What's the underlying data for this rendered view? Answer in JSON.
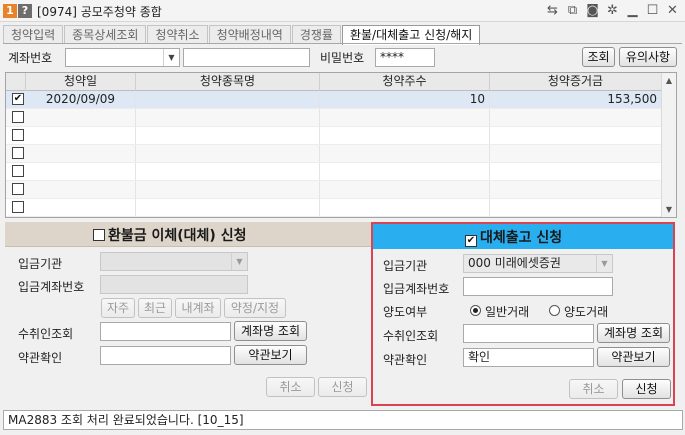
{
  "window": {
    "badge1": "1",
    "badge2": "?",
    "title": "[0974] 공모주청약 종합",
    "icons": [
      "sync-icon",
      "copy-icon",
      "camera-icon",
      "gear-icon",
      "minimize-icon",
      "restore-icon",
      "close-icon"
    ]
  },
  "tabs": [
    {
      "label": "청약입력"
    },
    {
      "label": "종목상세조회"
    },
    {
      "label": "청약취소"
    },
    {
      "label": "청약배정내역"
    },
    {
      "label": "경쟁률"
    },
    {
      "label": "환불/대체출고 신청/해지"
    }
  ],
  "active_tab": 5,
  "search": {
    "account_label": "계좌번호",
    "account_value": "",
    "account_name_value": "",
    "password_label": "비밀번호",
    "password_value": "****",
    "query_button": "조회",
    "notice_button": "유의사항"
  },
  "grid": {
    "headers": [
      "청약일",
      "청약종목명",
      "청약주수",
      "청약증거금"
    ],
    "rows": [
      {
        "checked": true,
        "date": "2020/09/09",
        "name": "",
        "qty": "10",
        "deposit": "153,500"
      },
      {
        "checked": false,
        "date": "",
        "name": "",
        "qty": "",
        "deposit": ""
      },
      {
        "checked": false,
        "date": "",
        "name": "",
        "qty": "",
        "deposit": ""
      },
      {
        "checked": false,
        "date": "",
        "name": "",
        "qty": "",
        "deposit": ""
      },
      {
        "checked": false,
        "date": "",
        "name": "",
        "qty": "",
        "deposit": ""
      },
      {
        "checked": false,
        "date": "",
        "name": "",
        "qty": "",
        "deposit": ""
      },
      {
        "checked": false,
        "date": "",
        "name": "",
        "qty": "",
        "deposit": ""
      }
    ]
  },
  "refund_panel": {
    "title": "환불금 이체(대체) 신청",
    "checked": false,
    "bank_label": "입금기관",
    "bank_value": "",
    "account_label": "입금계좌번호",
    "account_value": "",
    "quick_buttons": [
      "자주",
      "최근",
      "내계좌",
      "약정/지정"
    ],
    "recipient_label": "수취인조회",
    "recipient_value": "",
    "account_name_button": "계좌명 조회",
    "terms_label": "약관확인",
    "terms_value": "",
    "terms_button": "약관보기",
    "cancel_button": "취소",
    "apply_button": "신청"
  },
  "transfer_panel": {
    "title": "대체출고 신청",
    "checked": true,
    "bank_label": "입금기관",
    "bank_value": "000 미래에셋증권",
    "account_label": "입금계좌번호",
    "account_value": "",
    "transfer_type_label": "양도여부",
    "options": [
      "일반거래",
      "양도거래"
    ],
    "selected_option": 0,
    "recipient_label": "수취인조회",
    "recipient_value": "",
    "account_name_button": "계좌명 조회",
    "terms_label": "약관확인",
    "terms_value": "확인",
    "terms_button": "약관보기",
    "cancel_button": "취소",
    "apply_button": "신청"
  },
  "status": {
    "message": "MA2883 조회 처리 완료되었습니다. [10_15]"
  }
}
